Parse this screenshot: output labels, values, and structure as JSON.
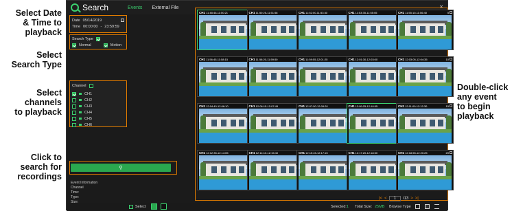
{
  "annotations": {
    "date_time": [
      "Select Date",
      "& Time to",
      "playback"
    ],
    "search_type": [
      "Select",
      "Search Type"
    ],
    "channels": [
      "Select",
      "channels",
      "to playback"
    ],
    "search": [
      "Click to",
      "search for",
      "recordings"
    ],
    "events": [
      "Double-click",
      "any event",
      "to begin",
      "playback"
    ]
  },
  "header": {
    "title": "Search",
    "tabs": [
      "Events",
      "External File"
    ],
    "close": "×"
  },
  "sidebar": {
    "date_label": "Date",
    "date_value": "05/14/2019",
    "time_label": "Time",
    "time_start": "00:00:00",
    "time_sep": "-",
    "time_end": "23:59:59",
    "search_type_label": "Search Type",
    "type_normal": "Normal",
    "type_motion": "Motion",
    "channel_label": "Channel",
    "channels": [
      "CH1",
      "CH2",
      "CH3",
      "CH4",
      "CH5",
      "CH6"
    ],
    "search_icon": "⚲",
    "event_info_label": "Event Information",
    "event_fields": [
      "Channel",
      "Time:",
      "Type:",
      "Size:"
    ]
  },
  "grid": {
    "cells": [
      {
        "ch": "CH1",
        "time": "11:48:46-11:50:21",
        "num": "1"
      },
      {
        "ch": "CH1",
        "time": "11:50:25-11:51:56",
        "num": "2"
      },
      {
        "ch": "CH1",
        "time": "11:52:00-11:53:30",
        "num": "3"
      },
      {
        "ch": "CH1",
        "time": "11:53:35-11:55:05",
        "num": "4"
      },
      {
        "ch": "CH1",
        "time": "11:55:10-11:56:40",
        "num": "5"
      },
      {
        "ch": "CH1",
        "time": "11:56:45-11:58:15",
        "num": "6"
      },
      {
        "ch": "CH1",
        "time": "11:58:20-11:59:50",
        "num": "7"
      },
      {
        "ch": "CH1",
        "time": "11:59:55-12:01:25",
        "num": "8"
      },
      {
        "ch": "CH1",
        "time": "12:01:30-12:03:00",
        "num": "9"
      },
      {
        "ch": "CH1",
        "time": "12:03:05-12:04:35",
        "num": "10"
      },
      {
        "ch": "CH1",
        "time": "12:04:40-12:06:10",
        "num": "11"
      },
      {
        "ch": "CH1",
        "time": "12:06:15-12:07:45",
        "num": "12"
      },
      {
        "ch": "CH1",
        "time": "12:07:50-12:09:20",
        "num": "13"
      },
      {
        "ch": "CH1",
        "time": "12:09:25-12:10:55",
        "num": "14"
      },
      {
        "ch": "CH1",
        "time": "12:11:00-12:12:30",
        "num": "15"
      },
      {
        "ch": "CH1",
        "time": "12:12:35-12:14:05",
        "num": "16"
      },
      {
        "ch": "CH1",
        "time": "12:14:10-12:15:40",
        "num": "17"
      },
      {
        "ch": "CH1",
        "time": "12:15:45-12:17:15",
        "num": "18"
      },
      {
        "ch": "CH1",
        "time": "12:17:20-12:18:50",
        "num": "19"
      },
      {
        "ch": "CH1",
        "time": "12:18:55-12:20:25",
        "num": "20"
      }
    ],
    "selected": [
      "1",
      "14"
    ]
  },
  "pager": {
    "first": "|<",
    "prev": "<",
    "page": "1",
    "total": "/13",
    "next": ">",
    "last": ">|"
  },
  "bottom": {
    "select_label": "Select",
    "selected_label": "Selected:",
    "selected_value": "1",
    "total_size_label": "Total Size:",
    "total_size_value": "25MB",
    "browse_type_label": "Browse Type"
  },
  "colors": {
    "accent": "#3bd16f",
    "highlight": "#e07b00"
  }
}
